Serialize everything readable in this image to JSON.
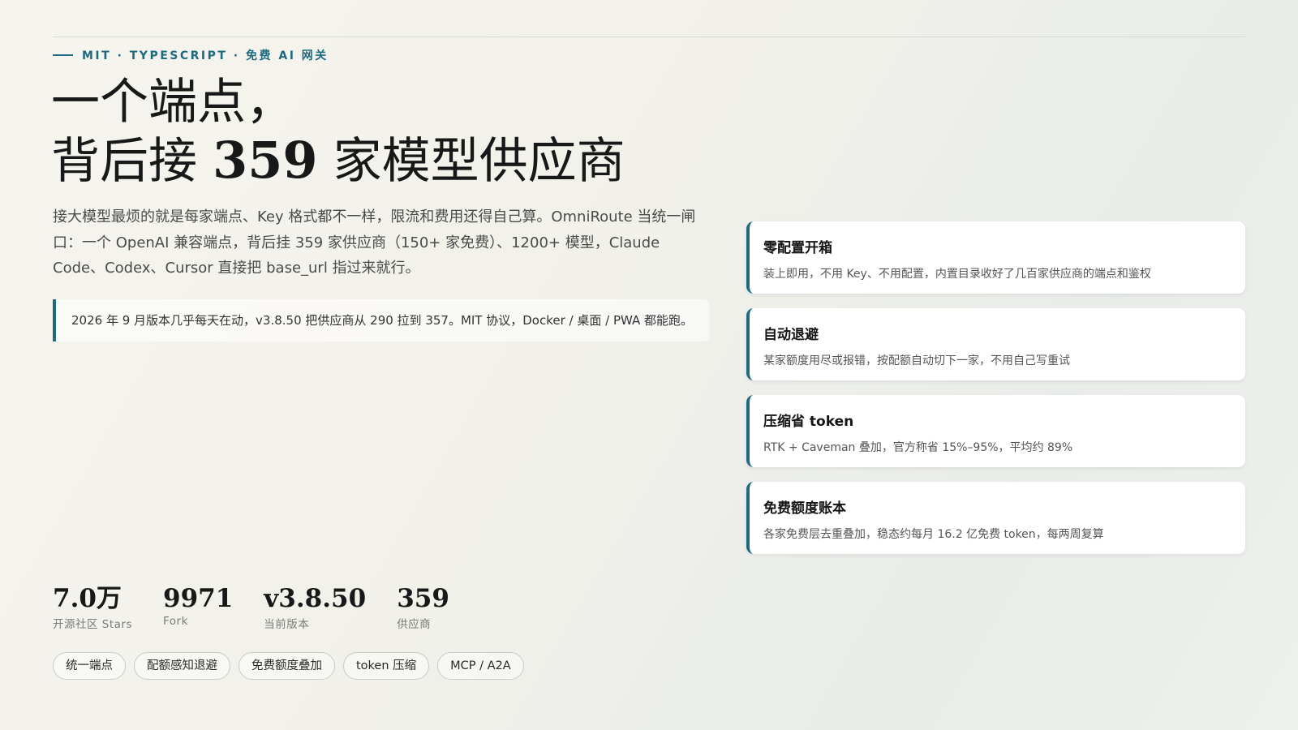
{
  "kicker": "MIT · TYPESCRIPT · 免费 AI 网关",
  "headline": {
    "line1": "一个端点，",
    "line2_prefix": "背后接 ",
    "line2_number": "359",
    "line2_suffix": " 家模型供应商"
  },
  "lede": "接大模型最烦的就是每家端点、Key 格式都不一样，限流和费用还得自己算。OmniRoute 当统一闸口：一个 OpenAI 兼容端点，背后挂 359 家供应商（150+ 家免费）、1200+ 模型，Claude Code、Codex、Cursor 直接把 base_url 指过来就行。",
  "note": "2026 年 9 月版本几乎每天在动，v3.8.50 把供应商从 290 拉到 357。MIT 协议，Docker / 桌面 / PWA 都能跑。",
  "features": [
    {
      "title": "零配置开箱",
      "desc": "装上即用，不用 Key、不用配置，内置目录收好了几百家供应商的端点和鉴权"
    },
    {
      "title": "自动退避",
      "desc": "某家额度用尽或报错，按配额自动切下一家，不用自己写重试"
    },
    {
      "title": "压缩省 token",
      "desc": "RTK + Caveman 叠加，官方称省 15%–95%，平均约 89%"
    },
    {
      "title": "免费额度账本",
      "desc": "各家免费层去重叠加，稳态约每月 16.2 亿免费 token，每两周复算"
    }
  ],
  "stats": [
    {
      "value": "7.0万",
      "label": "开源社区 Stars"
    },
    {
      "value": "9971",
      "label": "Fork"
    },
    {
      "value": "v3.8.50",
      "label": "当前版本"
    },
    {
      "value": "359",
      "label": "供应商"
    }
  ],
  "tags": [
    "统一端点",
    "配额感知退避",
    "免费额度叠加",
    "token 压缩",
    "MCP / A2A"
  ],
  "colors": {
    "accent": "#1e6a80",
    "background": "#f3f2ec",
    "card": "#ffffff"
  }
}
